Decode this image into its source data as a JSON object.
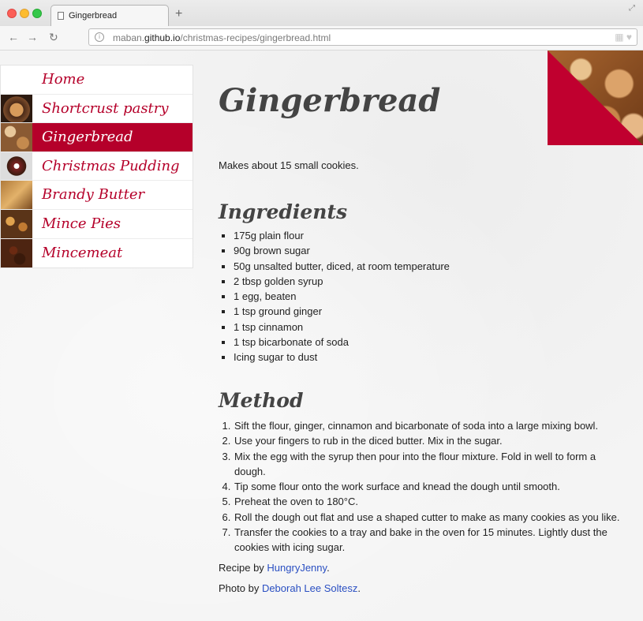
{
  "browser": {
    "tab_title": "Gingerbread",
    "url_prefix": "maban.",
    "url_host": "github.io",
    "url_path": "/christmas-recipes/gingerbread.html",
    "newtab_glyph": "+",
    "back_glyph": "←",
    "forward_glyph": "→",
    "reload_glyph": "↻",
    "info_glyph": "i"
  },
  "sidebar": {
    "items": [
      {
        "label": "Home",
        "thumb": "none"
      },
      {
        "label": "Shortcrust pastry",
        "thumb": "pastry-photo"
      },
      {
        "label": "Gingerbread",
        "thumb": "gingerbread-photo",
        "active": true
      },
      {
        "label": "Christmas Pudding",
        "thumb": "pudding-photo"
      },
      {
        "label": "Brandy Butter",
        "thumb": "brandy-butter-photo"
      },
      {
        "label": "Mince Pies",
        "thumb": "mince-pies-photo"
      },
      {
        "label": "Mincemeat",
        "thumb": "mincemeat-photo"
      }
    ]
  },
  "page": {
    "title": "Gingerbread",
    "intro": "Makes about 15 small cookies.",
    "ingredients_heading": "Ingredients",
    "ingredients": [
      "175g plain flour",
      "90g brown sugar",
      "50g unsalted butter, diced, at room temperature",
      "2 tbsp golden syrup",
      "1 egg, beaten",
      "1 tsp ground ginger",
      "1 tsp cinnamon",
      "1 tsp bicarbonate of soda",
      "Icing sugar to dust"
    ],
    "method_heading": "Method",
    "method": [
      "Sift the flour, ginger, cinnamon and bicarbonate of soda into a large mixing bowl.",
      "Use your fingers to rub in the diced butter. Mix in the sugar.",
      "Mix the egg with the syrup then pour into the flour mixture. Fold in well to form a dough.",
      "Tip some flour onto the work surface and knead the dough until smooth.",
      "Preheat the oven to 180°C.",
      "Roll the dough out flat and use a shaped cutter to make as many cookies as you like.",
      "Transfer the cookies to a tray and bake in the oven for 15 minutes. Lightly dust the cookies with icing sugar."
    ],
    "recipe_credit_prefix": "Recipe by ",
    "recipe_credit_name": "HungryJenny",
    "recipe_credit_suffix": ".",
    "photo_credit_prefix": "Photo by ",
    "photo_credit_name": "Deborah Lee Soltesz",
    "photo_credit_suffix": "."
  },
  "colors": {
    "accent": "#b5002a",
    "link": "#2a4fc2"
  }
}
